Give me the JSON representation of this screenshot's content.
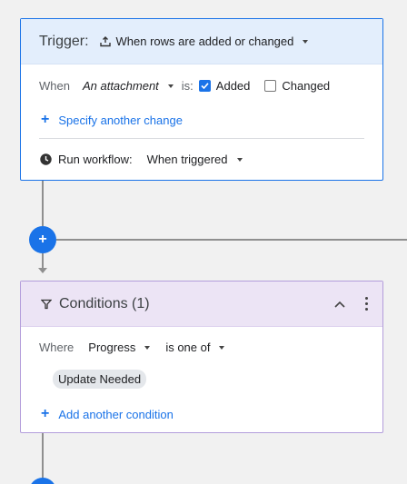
{
  "trigger": {
    "label": "Trigger:",
    "event": "When rows are added or changed",
    "when_label": "When",
    "field": "An attachment",
    "is_label": "is:",
    "added_label": "Added",
    "added_checked": true,
    "changed_label": "Changed",
    "changed_checked": false,
    "add_change_label": "Specify another change",
    "run_label": "Run workflow:",
    "run_value": "When triggered"
  },
  "add_step_symbol": "+",
  "conditions": {
    "title": "Conditions (1)",
    "where_label": "Where",
    "field": "Progress",
    "operator": "is one of",
    "values": [
      "Update Needed"
    ],
    "add_condition_label": "Add another condition"
  },
  "icons": {
    "trigger_event": "upload-tray-icon",
    "clock": "clock-icon",
    "filter": "filter-icon",
    "collapse": "chevron-up-icon",
    "more": "more-vertical-icon"
  },
  "colors": {
    "accent": "#1a73e8",
    "trigger_header_bg": "#e3eefc",
    "conditions_header_bg": "#ece4f5",
    "conditions_border": "#b39ddb"
  }
}
